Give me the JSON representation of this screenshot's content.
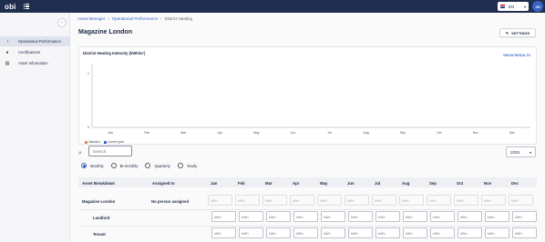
{
  "header": {
    "logo": "obi",
    "apps_icon": "grid-icon",
    "language": "EN",
    "avatar_initials": "JH"
  },
  "sidebar": {
    "items": [
      {
        "label": "Operational Performance",
        "icon": "gauge-icon",
        "active": true
      },
      {
        "label": "Certifications",
        "icon": "check-circle-icon",
        "active": false
      },
      {
        "label": "Asset Information",
        "icon": "table-icon",
        "active": false
      }
    ]
  },
  "breadcrumb": {
    "items": [
      "Asset Manager",
      "Operational Performance"
    ],
    "current": "District Heating"
  },
  "page": {
    "title": "Magazine London",
    "settings_label": "SETTINGS"
  },
  "chart_data": {
    "type": "bar",
    "title": "District Heating Intensity (kWh/m²)",
    "categories": [
      "Jan",
      "Feb",
      "Mar",
      "Apr",
      "May",
      "Jun",
      "Jul",
      "Aug",
      "Sep",
      "Oct",
      "Nov",
      "Dec"
    ],
    "series": [
      {
        "name": "Baseline",
        "values": [],
        "color": "#e8833a"
      },
      {
        "name": "Current year",
        "values": [],
        "color": "#3a66c9"
      }
    ],
    "yticks": [
      "1",
      "0"
    ],
    "ylim": [
      0,
      1
    ],
    "show_results_label": "SHOW RESULTS"
  },
  "filters": {
    "search_placeholder": "Search",
    "year": "2025",
    "periods": [
      {
        "label": "Monthly",
        "selected": true
      },
      {
        "label": "Bi-monthly",
        "selected": false
      },
      {
        "label": "Quarterly",
        "selected": false
      },
      {
        "label": "Yearly",
        "selected": false
      }
    ]
  },
  "table": {
    "columns": [
      "Asset Breakdown",
      "Assigned to",
      "Jan",
      "Feb",
      "Mar",
      "Apr",
      "May",
      "Jun",
      "Jul",
      "Aug",
      "Sep",
      "Oct",
      "Nov",
      "Dec"
    ],
    "rows": [
      {
        "name": "Magazine London",
        "assigned": "No person assigned",
        "cell_placeholder": "kWh",
        "disabled": true
      },
      {
        "name": "Landlord",
        "assigned": "",
        "cell_placeholder": "kWh",
        "disabled": false
      },
      {
        "name": "Tenant",
        "assigned": "",
        "cell_placeholder": "kWh",
        "disabled": false
      }
    ]
  }
}
